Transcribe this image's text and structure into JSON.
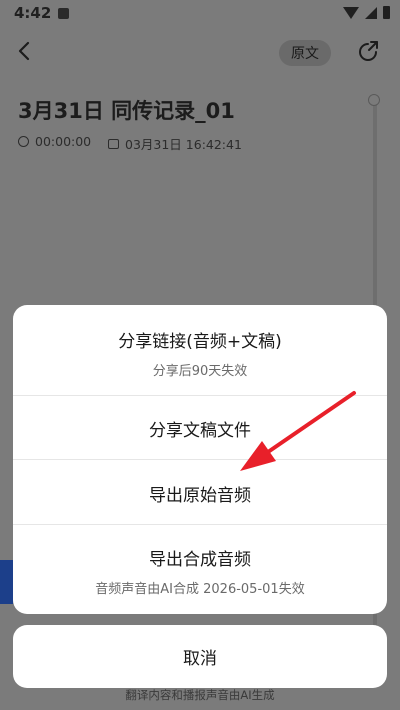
{
  "status_bar": {
    "time": "4:42",
    "icons": [
      "notification-icon",
      "wifi-icon",
      "signal-icon",
      "battery-icon"
    ]
  },
  "header": {
    "original_button_label": "原文",
    "icons": [
      "back-icon",
      "share-icon"
    ]
  },
  "document": {
    "title": "3月31日 同传记录_01",
    "duration": "00:00:00",
    "datetime": "03月31日 16:42:41"
  },
  "share_sheet": {
    "options": [
      {
        "label": "分享链接(音频+文稿)",
        "sublabel": "分享后90天失效"
      },
      {
        "label": "分享文稿文件"
      },
      {
        "label": "导出原始音频"
      },
      {
        "label": "导出合成音频",
        "sublabel": "音频声音由AI合成 2026-05-01失效"
      }
    ],
    "cancel_label": "取消"
  },
  "footer": {
    "note": "翻译内容和播报声音由AI生成"
  },
  "colors": {
    "overlay_background": "#7b7b7b",
    "sheet_background": "#ffffff",
    "annotation_arrow": "#e8202a"
  }
}
